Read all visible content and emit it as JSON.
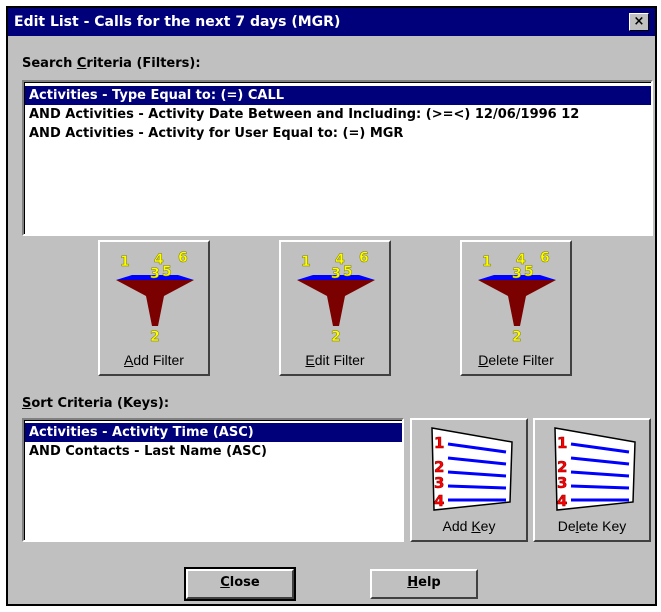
{
  "window": {
    "title": "Edit List - Calls for the next 7 days (MGR)",
    "close_glyph": "×"
  },
  "search": {
    "label_pre": "Search ",
    "label_accel": "C",
    "label_post": "riteria (Filters):",
    "items": [
      "Activities - Type Equal to: (=) CALL",
      "AND Activities - Activity Date Between and Including: (>=<) 12/06/1996 12",
      "AND Activities - Activity for User Equal to: (=) MGR"
    ],
    "selected_index": 0
  },
  "filter_buttons": {
    "add": {
      "accel": "A",
      "rest": "dd Filter"
    },
    "edit": {
      "accel": "E",
      "rest": "dit Filter"
    },
    "delete": {
      "accel": "D",
      "rest": "elete Filter"
    },
    "funnel_numbers": [
      "1",
      "4",
      "6",
      "3",
      "5",
      "2"
    ]
  },
  "sort": {
    "label_pre": "",
    "label_accel": "S",
    "label_post": "ort Criteria (Keys):",
    "items": [
      "Activities - Activity Time (ASC)",
      "AND Contacts - Last Name (ASC)"
    ],
    "selected_index": 0
  },
  "key_buttons": {
    "add": {
      "pre": "Add ",
      "accel": "K",
      "rest": "ey"
    },
    "delete": {
      "pre": "De",
      "accel": "l",
      "rest": "ete Key"
    },
    "list_numbers": [
      "1",
      "2",
      "3",
      "4"
    ]
  },
  "footer": {
    "close": {
      "accel": "C",
      "rest": "lose"
    },
    "help": {
      "accel": "H",
      "rest": "elp"
    }
  },
  "colors": {
    "titlebar": "#00007b",
    "face": "#c0c0c0",
    "funnel": "#7b0000",
    "funnel_top": "#0000ff",
    "numbers": "#ffff00"
  }
}
